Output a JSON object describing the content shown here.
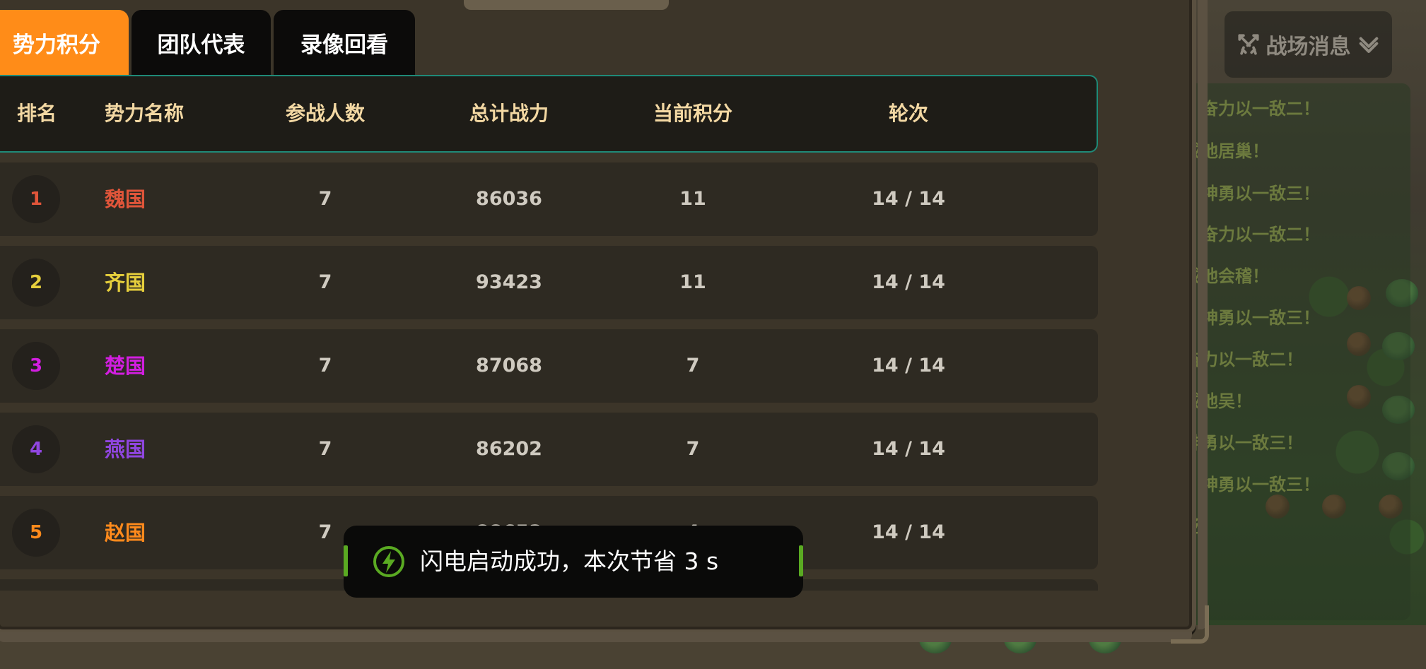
{
  "tabs": [
    {
      "label": "势力积分",
      "active": true
    },
    {
      "label": "团队代表",
      "active": false
    },
    {
      "label": "录像回看",
      "active": false
    }
  ],
  "table": {
    "headers": {
      "rank": "排名",
      "name": "势力名称",
      "count": "参战人数",
      "power": "总计战力",
      "score": "当前积分",
      "round": "轮次"
    },
    "rows": [
      {
        "rank": "1",
        "name": "魏国",
        "count": "7",
        "power": "86036",
        "score": "11",
        "round": "14 / 14",
        "color": "#e0553a"
      },
      {
        "rank": "2",
        "name": "齐国",
        "count": "7",
        "power": "93423",
        "score": "11",
        "round": "14 / 14",
        "color": "#e6cf3c"
      },
      {
        "rank": "3",
        "name": "楚国",
        "count": "7",
        "power": "87068",
        "score": "7",
        "round": "14 / 14",
        "color": "#d21ee0"
      },
      {
        "rank": "4",
        "name": "燕国",
        "count": "7",
        "power": "86202",
        "score": "7",
        "round": "14 / 14",
        "color": "#9046e0"
      },
      {
        "rank": "5",
        "name": "赵国",
        "count": "7",
        "power": "88653",
        "score": "4",
        "round": "14 / 14",
        "color": "#ff8a1c"
      }
    ]
  },
  "battle_news": {
    "button_label": "战场消息",
    "icon": "crossed-swords-icon",
    "lines": [
      "，奋力以一敌二！",
      "成池居巢！",
      "，神勇以一敌三！",
      "，奋力以一敌二！",
      "成池会稽！",
      "，神勇以一敌三！",
      "奋力以一敌二！",
      "成池吴！",
      "神勇以一敌三！",
      "，神勇以一敌三！",
      "场"
    ]
  },
  "toast": {
    "icon": "lightning-icon",
    "message": "闪电启动成功，本次节省 3 s"
  },
  "colors": {
    "active_tab": "#ff8c18",
    "header_text": "#f3d8a3",
    "header_border": "#1f8a78",
    "toast_accent": "#5aaa22"
  }
}
